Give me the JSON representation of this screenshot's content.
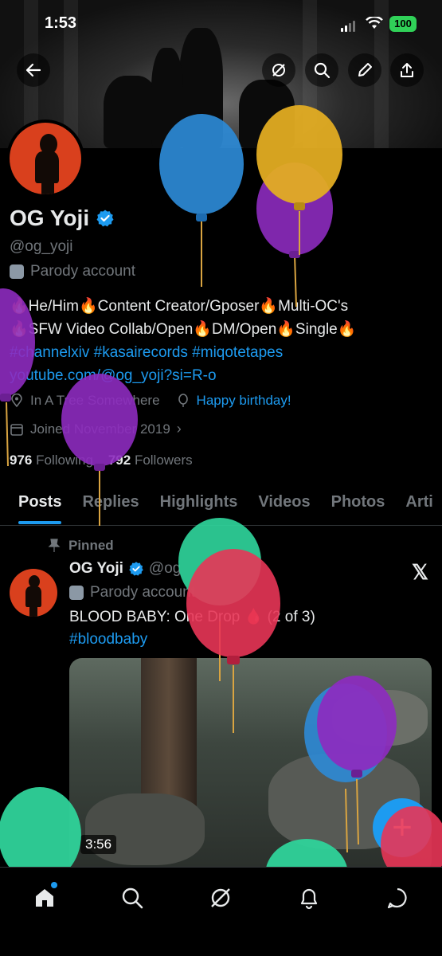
{
  "status": {
    "time": "1:53",
    "battery": "100"
  },
  "profile": {
    "name": "OG Yoji",
    "handle": "@og_yoji",
    "label": "Parody account",
    "bio_line1": "🔥He/Him🔥Content Creator/Gposer🔥Multi-OC's",
    "bio_line2": "🔥SFW Video Collab/Open🔥DM/Open🔥Single🔥",
    "hashtags": "#channelxiv #kasairecords #miqotetapes",
    "website": "youtube.com/@og_yoji?si=R-o",
    "location": "In A Tree Somewhere",
    "birthday": "Happy birthday!",
    "joined": "Joined November 2019",
    "following_count": "976",
    "following_label": "Following",
    "followers_count": "792",
    "followers_label": "Followers"
  },
  "tabs": [
    "Posts",
    "Replies",
    "Highlights",
    "Videos",
    "Photos",
    "Arti"
  ],
  "post": {
    "pinned_label": "Pinned",
    "author": "OG Yoji",
    "handle": "@og",
    "label": "Parody account",
    "text": "BLOOD BABY: One Drop 🩸 (2 of 3)",
    "hashtag": "#bloodbaby",
    "duration": "3:56"
  },
  "fab": {
    "label": "+"
  },
  "colors": {
    "accent": "#1d9bf0",
    "background": "#000000",
    "muted": "#71767b"
  },
  "icons": [
    "back-arrow-icon",
    "grok-icon",
    "search-icon",
    "edit-icon",
    "share-icon",
    "verified-badge-icon",
    "mask-icon",
    "location-icon",
    "balloon-icon",
    "calendar-icon",
    "pin-icon",
    "x-logo-icon",
    "home-icon",
    "explore-icon",
    "grok-nav-icon",
    "notifications-icon",
    "messages-icon"
  ]
}
